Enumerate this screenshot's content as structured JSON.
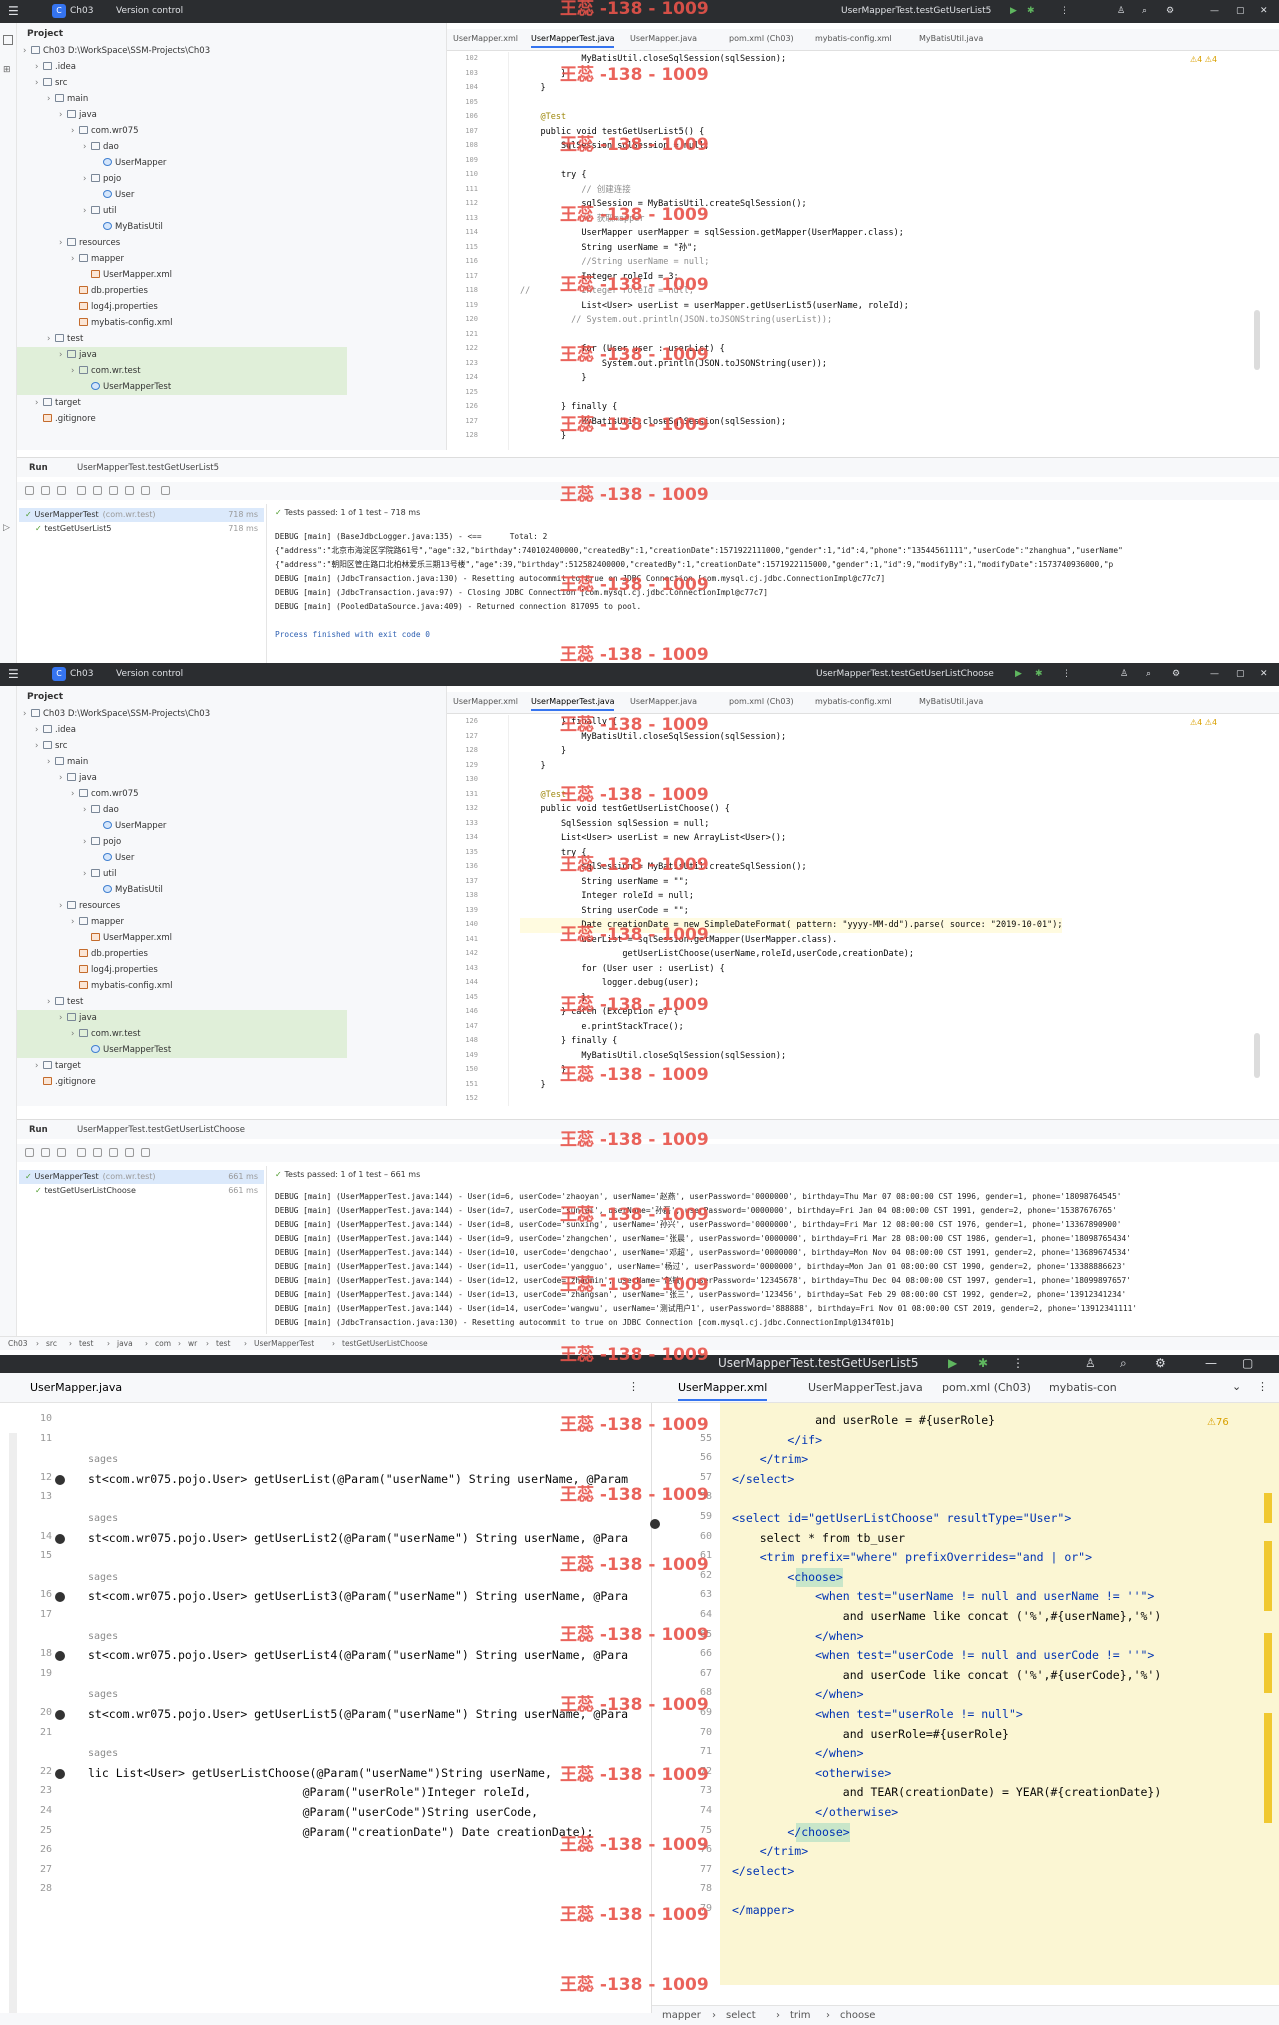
{
  "shot1": {
    "titlebar": {
      "project": "Ch03",
      "vcs": "Version control",
      "run_config": "UserMapperTest.testGetUserList5"
    },
    "project_label": "Project",
    "tree": [
      {
        "t": "Ch03  D:\\WorkSpace\\SSM-Projects\\Ch03",
        "d": 0,
        "k": "dir"
      },
      {
        "t": ".idea",
        "d": 1,
        "k": "dir"
      },
      {
        "t": "src",
        "d": 1,
        "k": "dir"
      },
      {
        "t": "main",
        "d": 2,
        "k": "dir"
      },
      {
        "t": "java",
        "d": 3,
        "k": "dir"
      },
      {
        "t": "com.wr075",
        "d": 4,
        "k": "dir"
      },
      {
        "t": "dao",
        "d": 5,
        "k": "dir"
      },
      {
        "t": "UserMapper",
        "d": 6,
        "k": "cls"
      },
      {
        "t": "pojo",
        "d": 5,
        "k": "dir"
      },
      {
        "t": "User",
        "d": 6,
        "k": "cls"
      },
      {
        "t": "util",
        "d": 5,
        "k": "dir"
      },
      {
        "t": "MyBatisUtil",
        "d": 6,
        "k": "cls"
      },
      {
        "t": "resources",
        "d": 3,
        "k": "dir"
      },
      {
        "t": "mapper",
        "d": 4,
        "k": "dir"
      },
      {
        "t": "UserMapper.xml",
        "d": 5,
        "k": "file"
      },
      {
        "t": "db.properties",
        "d": 4,
        "k": "file"
      },
      {
        "t": "log4j.properties",
        "d": 4,
        "k": "file"
      },
      {
        "t": "mybatis-config.xml",
        "d": 4,
        "k": "file"
      },
      {
        "t": "test",
        "d": 2,
        "k": "dir"
      },
      {
        "t": "java",
        "d": 3,
        "k": "dir",
        "sel": true
      },
      {
        "t": "com.wr.test",
        "d": 4,
        "k": "dir",
        "sel": true
      },
      {
        "t": "UserMapperTest",
        "d": 5,
        "k": "cls",
        "sel": true
      },
      {
        "t": "target",
        "d": 1,
        "k": "dir"
      },
      {
        "t": ".gitignore",
        "d": 1,
        "k": "file"
      }
    ],
    "tabs": [
      "UserMapper.xml",
      "UserMapperTest.java",
      "UserMapper.java",
      "pom.xml (Ch03)",
      "mybatis-config.xml",
      "MyBatisUtil.java"
    ],
    "inspections": "⚠4 ⚠4",
    "code": [
      {
        "n": "102",
        "c": "            MyBatisUtil.closeSqlSession(sqlSession);"
      },
      {
        "n": "103",
        "c": "        }"
      },
      {
        "n": "104",
        "c": "    }"
      },
      {
        "n": "105",
        "c": ""
      },
      {
        "n": "106",
        "c": "    @Test"
      },
      {
        "n": "107",
        "c": "    public void testGetUserList5() {"
      },
      {
        "n": "108",
        "c": "        SqlSession sqlSession = null;"
      },
      {
        "n": "109",
        "c": ""
      },
      {
        "n": "110",
        "c": "        try {"
      },
      {
        "n": "111",
        "c": "            // 创建连接"
      },
      {
        "n": "112",
        "c": "            sqlSession = MyBatisUtil.createSqlSession();"
      },
      {
        "n": "113",
        "c": "            // 获取mapper"
      },
      {
        "n": "114",
        "c": "            UserMapper userMapper = sqlSession.getMapper(UserMapper.class);"
      },
      {
        "n": "115",
        "c": "            String userName = \"孙\";"
      },
      {
        "n": "116",
        "c": "            //String userName = null;"
      },
      {
        "n": "117",
        "c": "            Integer roleId = 3;"
      },
      {
        "n": "118",
        "c": "//          Integer roleId = null;"
      },
      {
        "n": "119",
        "c": "            List<User> userList = userMapper.getUserList5(userName, roleId);"
      },
      {
        "n": "120",
        "c": "          // System.out.println(JSON.toJSONString(userList));"
      },
      {
        "n": "121",
        "c": ""
      },
      {
        "n": "122",
        "c": "            for (User user : userList) {"
      },
      {
        "n": "123",
        "c": "                System.out.println(JSON.toJSONString(user));"
      },
      {
        "n": "124",
        "c": "            }"
      },
      {
        "n": "125",
        "c": ""
      },
      {
        "n": "126",
        "c": "        } finally {"
      },
      {
        "n": "127",
        "c": "            MyBatisUtil.closeSqlSession(sqlSession);"
      },
      {
        "n": "128",
        "c": "        }"
      }
    ],
    "run_tab": "Run",
    "run_config_tab": "UserMapperTest.testGetUserList5",
    "test_tree": [
      {
        "t": "UserMapperTest",
        "sub": "(com.wr.test)",
        "time": "718 ms",
        "sel": true
      },
      {
        "t": "testGetUserList5",
        "sub": "",
        "time": "718 ms"
      }
    ],
    "tests_passed": "Tests passed: 1 of 1 test – 718 ms",
    "output": [
      "DEBUG [main] (BaseJdbcLogger.java:135) - <==      Total: 2",
      "{\"address\":\"北京市海淀区学院路61号\",\"age\":32,\"birthday\":740102400000,\"createdBy\":1,\"creationDate\":1571922111000,\"gender\":1,\"id\":4,\"phone\":\"13544561111\",\"userCode\":\"zhanghua\",\"userName\"",
      "{\"address\":\"朝阳区管庄路口北柏林爱乐三期13号楼\",\"age\":39,\"birthday\":512582400000,\"createdBy\":1,\"creationDate\":1571922115000,\"gender\":1,\"id\":9,\"modifyBy\":1,\"modifyDate\":1573740936000,\"p",
      "DEBUG [main] (JdbcTransaction.java:130) - Resetting autocommit to true on JDBC Connection [com.mysql.cj.jdbc.ConnectionImpl@c77c7]",
      "DEBUG [main] (JdbcTransaction.java:97) - Closing JDBC Connection [com.mysql.cj.jdbc.ConnectionImpl@c77c7]",
      "DEBUG [main] (PooledDataSource.java:409) - Returned connection 817095 to pool.",
      "",
      "Process finished with exit code 0"
    ]
  },
  "shot2": {
    "titlebar": {
      "project": "Ch03",
      "vcs": "Version control",
      "run_config": "UserMapperTest.testGetUserListChoose"
    },
    "project_label": "Project",
    "tabs": [
      "UserMapper.xml",
      "UserMapperTest.java",
      "UserMapper.java",
      "pom.xml (Ch03)",
      "mybatis-config.xml",
      "MyBatisUtil.java"
    ],
    "inspections": "⚠4 ⚠4",
    "code": [
      {
        "n": "126",
        "c": "        } finally {"
      },
      {
        "n": "127",
        "c": "            MyBatisUtil.closeSqlSession(sqlSession);"
      },
      {
        "n": "128",
        "c": "        }"
      },
      {
        "n": "129",
        "c": "    }"
      },
      {
        "n": "130",
        "c": ""
      },
      {
        "n": "131",
        "c": "    @Test"
      },
      {
        "n": "132",
        "c": "    public void testGetUserListChoose() {"
      },
      {
        "n": "133",
        "c": "        SqlSession sqlSession = null;"
      },
      {
        "n": "134",
        "c": "        List<User> userList = new ArrayList<User>();"
      },
      {
        "n": "135",
        "c": "        try {"
      },
      {
        "n": "136",
        "c": "            sqlSession = MyBatisUtil.createSqlSession();"
      },
      {
        "n": "137",
        "c": "            String userName = \"\";"
      },
      {
        "n": "138",
        "c": "            Integer roleId = null;"
      },
      {
        "n": "139",
        "c": "            String userCode = \"\";"
      },
      {
        "n": "140",
        "c": "            Date creationDate = new SimpleDateFormat( pattern: \"yyyy-MM-dd\").parse( source: \"2019-10-01\");"
      },
      {
        "n": "141",
        "c": "            userList = sqlSession.getMapper(UserMapper.class)."
      },
      {
        "n": "142",
        "c": "                    getUserListChoose(userName,roleId,userCode,creationDate);"
      },
      {
        "n": "143",
        "c": "            for (User user : userList) {"
      },
      {
        "n": "144",
        "c": "                logger.debug(user);"
      },
      {
        "n": "145",
        "c": "            }"
      },
      {
        "n": "146",
        "c": "        } catch (Exception e) {"
      },
      {
        "n": "147",
        "c": "            e.printStackTrace();"
      },
      {
        "n": "148",
        "c": "        } finally {"
      },
      {
        "n": "149",
        "c": "            MyBatisUtil.closeSqlSession(sqlSession);"
      },
      {
        "n": "150",
        "c": "        }"
      },
      {
        "n": "151",
        "c": "    }"
      },
      {
        "n": "152",
        "c": ""
      }
    ],
    "run_tab": "Run",
    "run_config_tab": "UserMapperTest.testGetUserListChoose",
    "test_tree": [
      {
        "t": "UserMapperTest",
        "sub": "(com.wr.test)",
        "time": "661 ms",
        "sel": true
      },
      {
        "t": "testGetUserListChoose",
        "sub": "",
        "time": "661 ms"
      }
    ],
    "tests_passed": "Tests passed: 1 of 1 test – 661 ms",
    "output": [
      "DEBUG [main] (UserMapperTest.java:144) - User(id=6, userCode='zhaoyan', userName='赵燕', userPassword='0000000', birthday=Thu Mar 07 08:00:00 CST 1996, gender=1, phone='18098764545'",
      "DEBUG [main] (UserMapperTest.java:144) - User(id=7, userCode='sunlei', userName='孙磊', userPassword='0000000', birthday=Fri Jan 04 08:00:00 CST 1991, gender=2, phone='15387676765'",
      "DEBUG [main] (UserMapperTest.java:144) - User(id=8, userCode='sunxing', userName='孙兴', userPassword='0000000', birthday=Fri Mar 12 08:00:00 CST 1976, gender=1, phone='13367890900'",
      "DEBUG [main] (UserMapperTest.java:144) - User(id=9, userCode='zhangchen', userName='张晨', userPassword='0000000', birthday=Fri Mar 28 08:00:00 CST 1986, gender=1, phone='18098765434'",
      "DEBUG [main] (UserMapperTest.java:144) - User(id=10, userCode='dengchao', userName='邓超', userPassword='0000000', birthday=Mon Nov 04 08:00:00 CST 1991, gender=2, phone='13689674534'",
      "DEBUG [main] (UserMapperTest.java:144) - User(id=11, userCode='yangguo', userName='杨过', userPassword='0000000', birthday=Mon Jan 01 08:00:00 CST 1990, gender=2, phone='13388886623'",
      "DEBUG [main] (UserMapperTest.java:144) - User(id=12, userCode='zhaomin', userName='赵敏', userPassword='12345678', birthday=Thu Dec 04 08:00:00 CST 1997, gender=1, phone='18099897657'",
      "DEBUG [main] (UserMapperTest.java:144) - User(id=13, userCode='zhangsan', userName='张三', userPassword='123456', birthday=Sat Feb 29 08:00:00 CST 1992, gender=2, phone='13912341234'",
      "DEBUG [main] (UserMapperTest.java:144) - User(id=14, userCode='wangwu', userName='测试用户1', userPassword='888888', birthday=Fri Nov 01 08:00:00 CST 2019, gender=2, phone='13912341111'",
      "DEBUG [main] (JdbcTransaction.java:130) - Resetting autocommit to true on JDBC Connection [com.mysql.cj.jdbc.ConnectionImpl@134f01b]"
    ],
    "breadcrumb": [
      "Ch03",
      "src",
      "test",
      "java",
      "com",
      "wr",
      "test",
      "UserMapperTest",
      "testGetUserListChoose"
    ]
  },
  "shot3": {
    "titlebar": {
      "run_config": "UserMapperTest.testGetUserList5"
    },
    "left_tab": "UserMapper.java",
    "right_tabs": [
      "UserMapper.xml",
      "UserMapperTest.java",
      "pom.xml (Ch03)",
      "mybatis-con"
    ],
    "inspections": "⚠76",
    "left_code": [
      {
        "n": "10",
        "c": ""
      },
      {
        "n": "11",
        "c": ""
      },
      {
        "n": "",
        "c": "sages",
        "cm": true
      },
      {
        "n": "12",
        "c": "st<com.wr075.pojo.User> getUserList(@Param(\"userName\") String userName, @Param"
      },
      {
        "n": "13",
        "c": ""
      },
      {
        "n": "",
        "c": "sages",
        "cm": true
      },
      {
        "n": "14",
        "c": "st<com.wr075.pojo.User> getUserList2(@Param(\"userName\") String userName, @Para"
      },
      {
        "n": "15",
        "c": ""
      },
      {
        "n": "",
        "c": "sages",
        "cm": true
      },
      {
        "n": "16",
        "c": "st<com.wr075.pojo.User> getUserList3(@Param(\"userName\") String userName, @Para"
      },
      {
        "n": "17",
        "c": ""
      },
      {
        "n": "",
        "c": "sages",
        "cm": true
      },
      {
        "n": "18",
        "c": "st<com.wr075.pojo.User> getUserList4(@Param(\"userName\") String userName, @Para"
      },
      {
        "n": "19",
        "c": ""
      },
      {
        "n": "",
        "c": "sages",
        "cm": true
      },
      {
        "n": "20",
        "c": "st<com.wr075.pojo.User> getUserList5(@Param(\"userName\") String userName, @Para"
      },
      {
        "n": "21",
        "c": ""
      },
      {
        "n": "",
        "c": "sages",
        "cm": true
      },
      {
        "n": "22",
        "c": "lic List<User> getUserListChoose(@Param(\"userName\")String userName,"
      },
      {
        "n": "23",
        "c": "                               @Param(\"userRole\")Integer roleId,"
      },
      {
        "n": "24",
        "c": "                               @Param(\"userCode\")String userCode,"
      },
      {
        "n": "25",
        "c": "                               @Param(\"creationDate\") Date creationDate);"
      },
      {
        "n": "26",
        "c": ""
      },
      {
        "n": "27",
        "c": ""
      },
      {
        "n": "28",
        "c": ""
      }
    ],
    "right_code": [
      {
        "n": "",
        "c": "            and userRole = #{userRole}"
      },
      {
        "n": "55",
        "c": "        </if>"
      },
      {
        "n": "56",
        "c": "    </trim>"
      },
      {
        "n": "57",
        "c": "</select>"
      },
      {
        "n": "58",
        "c": ""
      },
      {
        "n": "59",
        "c": "<select id=\"getUserListChoose\" resultType=\"User\">"
      },
      {
        "n": "60",
        "c": "    select * from tb_user"
      },
      {
        "n": "61",
        "c": "    <trim prefix=\"where\" prefixOverrides=\"and | or\">"
      },
      {
        "n": "62",
        "c": "        <choose>"
      },
      {
        "n": "63",
        "c": "            <when test=\"userName != null and userName != ''\">"
      },
      {
        "n": "64",
        "c": "                and userName like concat ('%',#{userName},'%')"
      },
      {
        "n": "65",
        "c": "            </when>"
      },
      {
        "n": "66",
        "c": "            <when test=\"userCode != null and userCode != ''\">"
      },
      {
        "n": "67",
        "c": "                and userCode like concat ('%',#{userCode},'%')"
      },
      {
        "n": "68",
        "c": "            </when>"
      },
      {
        "n": "69",
        "c": "            <when test=\"userRole != null\">"
      },
      {
        "n": "70",
        "c": "                and userRole=#{userRole}"
      },
      {
        "n": "71",
        "c": "            </when>"
      },
      {
        "n": "72",
        "c": "            <otherwise>"
      },
      {
        "n": "73",
        "c": "                and TEAR(creationDate) = YEAR(#{creationDate})"
      },
      {
        "n": "74",
        "c": "            </otherwise>"
      },
      {
        "n": "75",
        "c": "        </choose>"
      },
      {
        "n": "76",
        "c": "    </trim>"
      },
      {
        "n": "77",
        "c": "</select>"
      },
      {
        "n": "78",
        "c": ""
      },
      {
        "n": "79",
        "c": "</mapper>"
      }
    ],
    "breadcrumb": [
      "mapper",
      "select",
      "trim",
      "choose"
    ]
  },
  "watermark": "王蕊 -138 - 1009"
}
